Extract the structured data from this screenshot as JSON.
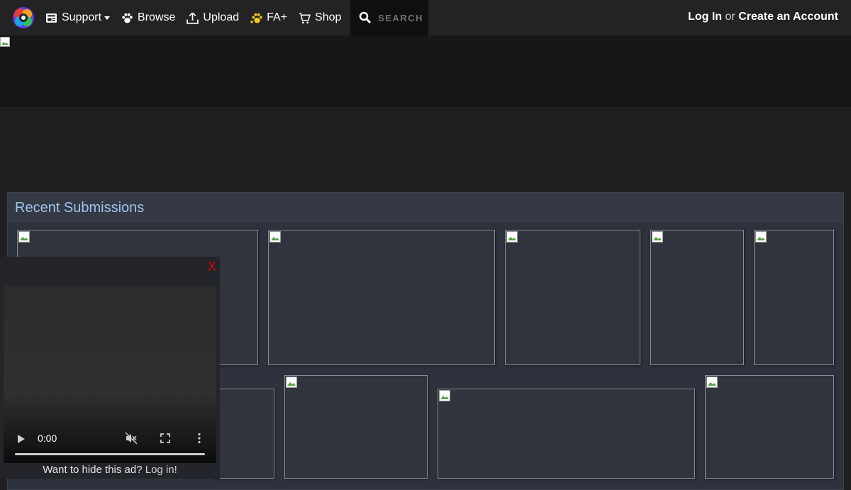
{
  "nav": {
    "support": "Support",
    "browse": "Browse",
    "upload": "Upload",
    "faplus": "FA+",
    "shop": "Shop",
    "search_label": "SEARCH"
  },
  "auth": {
    "login": "Log In",
    "or": "or",
    "create": "Create an Account"
  },
  "section": {
    "title": "Recent Submissions"
  },
  "ad": {
    "close": "X",
    "video_time": "0:00",
    "video_progress": 0,
    "hide_text": "Want to hide this ad?",
    "login_link": "Log in!"
  },
  "colors": {
    "accent_title": "#9ec4f0",
    "close": "#e00000",
    "faplus_icon": "#f3c622"
  }
}
